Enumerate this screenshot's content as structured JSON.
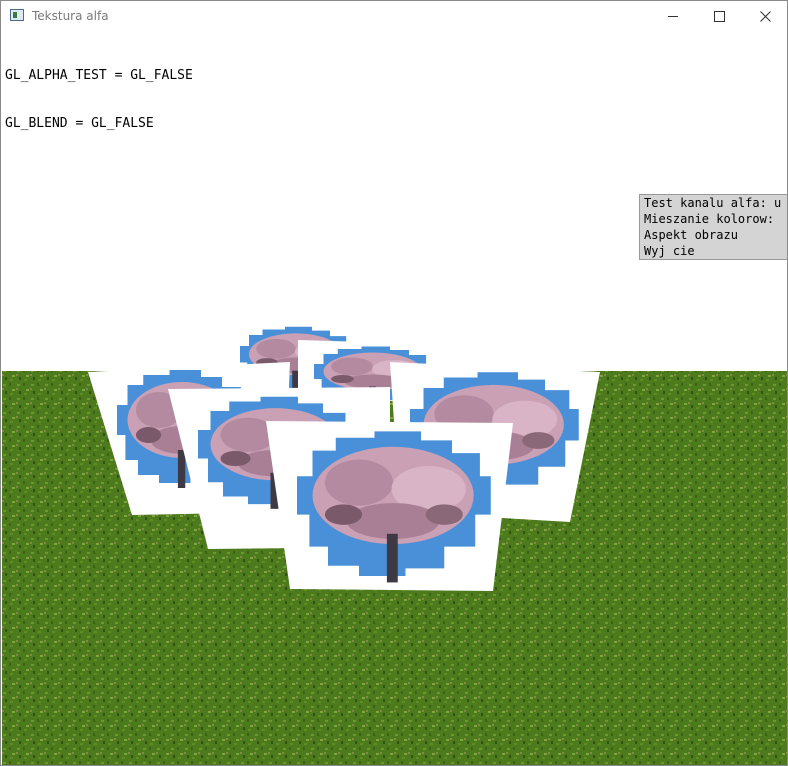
{
  "window": {
    "title": "Tekstura alfa"
  },
  "hud": {
    "lines": [
      "GL_ALPHA_TEST = GL_FALSE",
      "GL_BLEND = GL_FALSE"
    ]
  },
  "context_menu": {
    "items": [
      "Test kanalu alfa: u",
      "Mieszanie kolorow:",
      "Aspekt obrazu",
      "Wyj cie"
    ]
  },
  "colors": {
    "grass": "#4d7a1c",
    "sky": "#4a90d9",
    "blossom": "#c9a0b4",
    "menu_bg": "#d4d4d4"
  },
  "icons": [
    "app-icon",
    "minimize-icon",
    "maximize-icon",
    "close-icon"
  ]
}
